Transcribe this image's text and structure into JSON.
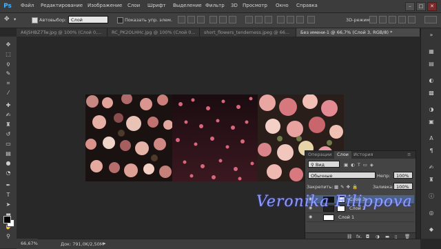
{
  "app": {
    "logo": "Ps"
  },
  "menu": [
    "Файл",
    "Редактирование",
    "Изображение",
    "Слои",
    "Шрифт",
    "Выделение",
    "Фильтр",
    "3D",
    "Просмотр",
    "Окно",
    "Справка"
  ],
  "window_controls": [
    "–",
    "□",
    "✕"
  ],
  "options": {
    "autoselect_label": "Автовыбор:",
    "autoselect_value": "Слой",
    "show_controls_label": "Показать упр. элем.",
    "mode_3d_label": "3D-режим:",
    "workspace_icon": "workspace-icon"
  },
  "tabs": [
    {
      "label": "A6jSHBZ7Tw.jpg @ 100% (Слой 0,...",
      "active": false
    },
    {
      "label": "RC_PK2OLHHc.jpg @ 100% (Слой 0...",
      "active": false
    },
    {
      "label": "short_flowers_tenderness.jpeg @ 66...",
      "active": false
    },
    {
      "label": "Без имени-1 @ 66,7% (Слой 3, RGB/8) *",
      "active": true
    }
  ],
  "tools": [
    "move-icon",
    "marquee-icon",
    "lasso-icon",
    "quick-select-icon",
    "crop-icon",
    "eyedropper-icon",
    "healing-icon",
    "brush-icon",
    "stamp-icon",
    "history-brush-icon",
    "eraser-icon",
    "gradient-icon",
    "blur-icon",
    "dodge-icon",
    "pen-icon",
    "type-icon",
    "path-select-icon",
    "shape-icon",
    "hand-icon",
    "zoom-icon"
  ],
  "layers_panel": {
    "tabs": [
      "Операции",
      "Слои",
      "История"
    ],
    "active_tab": 1,
    "filter_label": "Вид",
    "blend_mode": "Обычные",
    "opacity_label": "Непр:",
    "opacity_value": "100%",
    "lock_label": "Закрепить:",
    "fill_label": "Заливка:",
    "fill_value": "100%",
    "layers": [
      {
        "name": "Слой 3",
        "active": true
      },
      {
        "name": "Слой 2",
        "active": false
      },
      {
        "name": "Слой 1",
        "active": false
      }
    ],
    "footer_icons": [
      "link-icon",
      "fx-icon",
      "mask-icon",
      "adjustment-icon",
      "folder-icon",
      "new-layer-icon",
      "trash-icon"
    ],
    "footer_fx": "fx."
  },
  "status": {
    "zoom": "66,67%",
    "doc": "Док: 791,0K/2,50M"
  },
  "watermark": "Veronika Filippova"
}
